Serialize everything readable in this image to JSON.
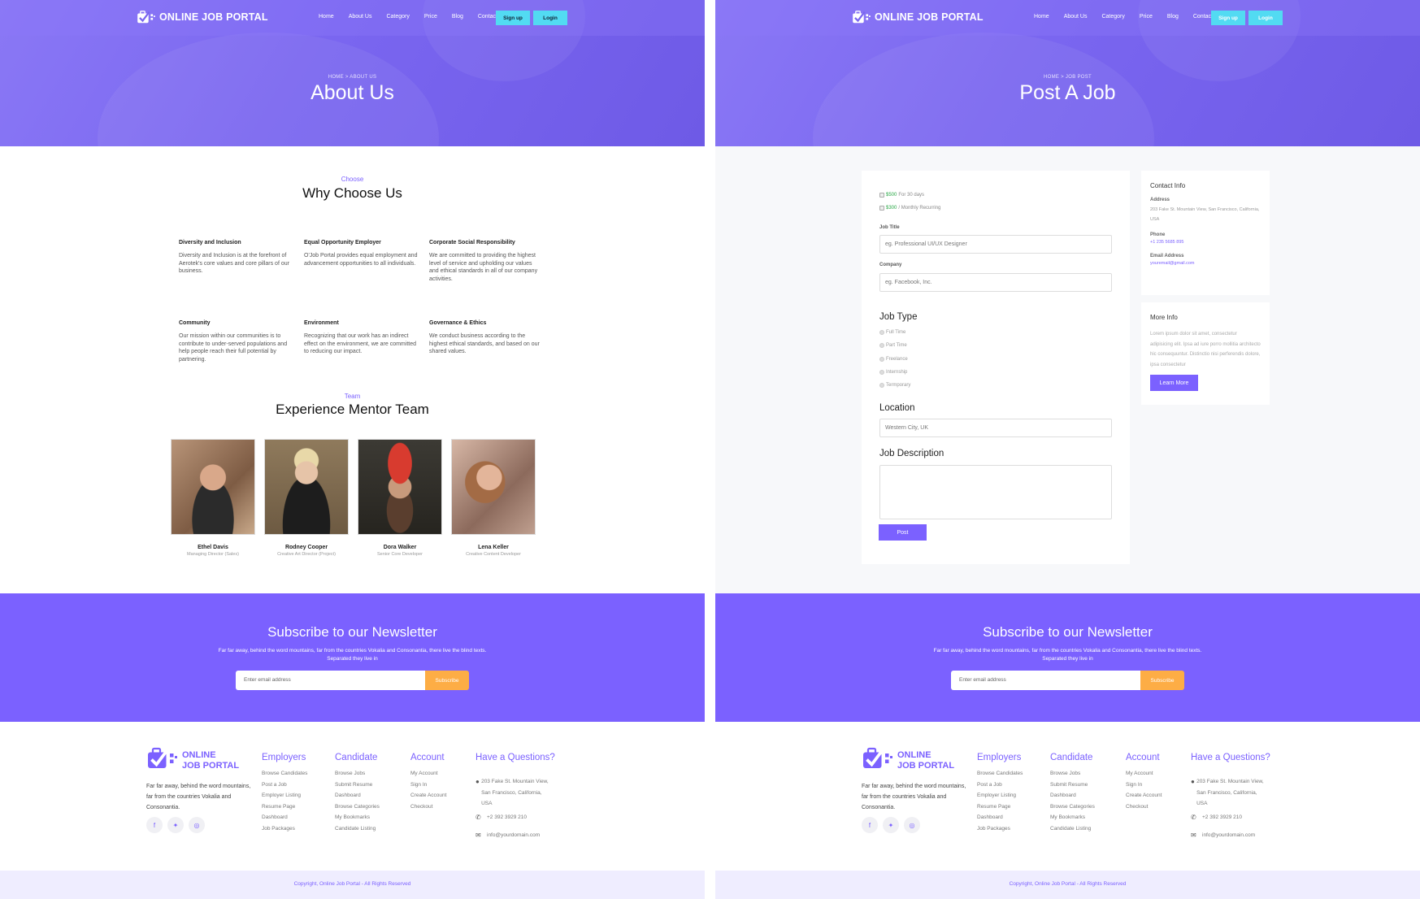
{
  "brand": {
    "name": "ONLINE JOB PORTAL",
    "footer_line1": "ONLINE",
    "footer_line2": "JOB PORTAL"
  },
  "nav": {
    "links": [
      "Home",
      "About Us",
      "Category",
      "Price",
      "Blog",
      "Contact us"
    ],
    "signup": "Sign up",
    "login": "Login"
  },
  "about_page": {
    "breadcrumb": "HOME >  ABOUT US",
    "title": "About Us",
    "why": {
      "kicker": "Choose",
      "title": "Why Choose Us",
      "features": [
        {
          "title": "Diversity and Inclusion",
          "text": "Diversity and Inclusion is at the forefront of Aerotek's core values and core pillars of our business."
        },
        {
          "title": "Equal Opportunity Employer",
          "text": "O'Job Portal provides equal employment and advancement opportunities to all individuals."
        },
        {
          "title": "Corporate Social Responsibility",
          "text": "We are committed to providing the highest level of service and upholding our values and ethical standards in all of our company activities."
        },
        {
          "title": "Community",
          "text": "Our mission within our communities is to contribute to under-served populations and help people reach their full potential by partnering."
        },
        {
          "title": "Environment",
          "text": "Recognizing that our work has an indirect effect on the environment, we are committed to reducing our impact."
        },
        {
          "title": "Governance & Ethics",
          "text": "We conduct business according to the highest ethical standards, and based on our shared values."
        }
      ]
    },
    "team": {
      "kicker": "Team",
      "title": "Experience Mentor Team",
      "members": [
        {
          "name": "Ethel Davis",
          "role": "Managing Director (Sales)"
        },
        {
          "name": "Rodney Cooper",
          "role": "Creative Art Director (Project)"
        },
        {
          "name": "Dora Walker",
          "role": "Senior Core Developer"
        },
        {
          "name": "Lena Keller",
          "role": "Creative Content Developer"
        }
      ]
    }
  },
  "post_page": {
    "breadcrumb": "HOME >  JOB POST",
    "title": "Post A Job",
    "plans": [
      {
        "price": "$500",
        "text": "For 30 days"
      },
      {
        "price": "$300",
        "text": "/ Monthly Recurring"
      }
    ],
    "job_title_label": "Job Title",
    "job_title_placeholder": "eg. Professional UI/UX Designer",
    "company_label": "Company",
    "company_placeholder": "eg. Facebook, Inc.",
    "job_type_heading": "Job Type",
    "job_types": [
      "Full Time",
      "Part Time",
      "Freelance",
      "Internship",
      "Termporary"
    ],
    "location_heading": "Location",
    "location_placeholder": "Western City, UK",
    "description_heading": "Job Description",
    "post_button": "Post",
    "contact": {
      "title": "Contact Info",
      "address_label": "Address",
      "address": "203 Fake St. Mountain View, San Francisco, California, USA",
      "phone_label": "Phone",
      "phone": "+1 235 5685 895",
      "email_label": "Email Address",
      "email": "youremail@gmail.com"
    },
    "more": {
      "title": "More Info",
      "text": "Lorem ipsum dolor sit amet, consectetur adipisicing elit. Ipsa ad iure porro mollitia architecto hic consequuntur. Distinctio nisi perferendis dolore, ipsa consectetur",
      "button": "Learn More"
    }
  },
  "newsletter": {
    "title": "Subscribe to our Newsletter",
    "text": "Far far away, behind the word mountains, far from the countries Vokalia and Consonantia, there live the blind texts. Separated they live in",
    "placeholder": "Enter email address",
    "button": "Subscribe"
  },
  "footer": {
    "description": "Far far away, behind the word mountains, far from the countries Vokalia and Consonantia.",
    "social": [
      "facebook-icon",
      "twitter-icon",
      "instagram-icon"
    ],
    "columns": [
      {
        "title": "Employers",
        "links": [
          "Browse Candidates",
          "Post a Job",
          "Employer Listing",
          "Resume Page",
          "Dashboard",
          "Job Packages"
        ]
      },
      {
        "title": "Candidate",
        "links": [
          "Browse Jobs",
          "Submit Resume",
          "Dashboard",
          "Browse Categories",
          "My Bookmarks",
          "Candidate Listing"
        ]
      },
      {
        "title": "Account",
        "links": [
          "My Account",
          "Sign In",
          "Create Account",
          "Checkout"
        ]
      }
    ],
    "questions": {
      "title": "Have a Questions?",
      "address": "203 Fake St. Mountain View, San Francisco, California, USA",
      "phone": "+2 392 3929 210",
      "email": "info@yourdomain.com"
    },
    "copyright": "Copyright, Online Job Portal - All Rights Reserved"
  },
  "colors": {
    "accent": "#7b61ff",
    "cyan": "#52dbf2",
    "orange": "#fdad45",
    "hero": "#7a66f0"
  }
}
